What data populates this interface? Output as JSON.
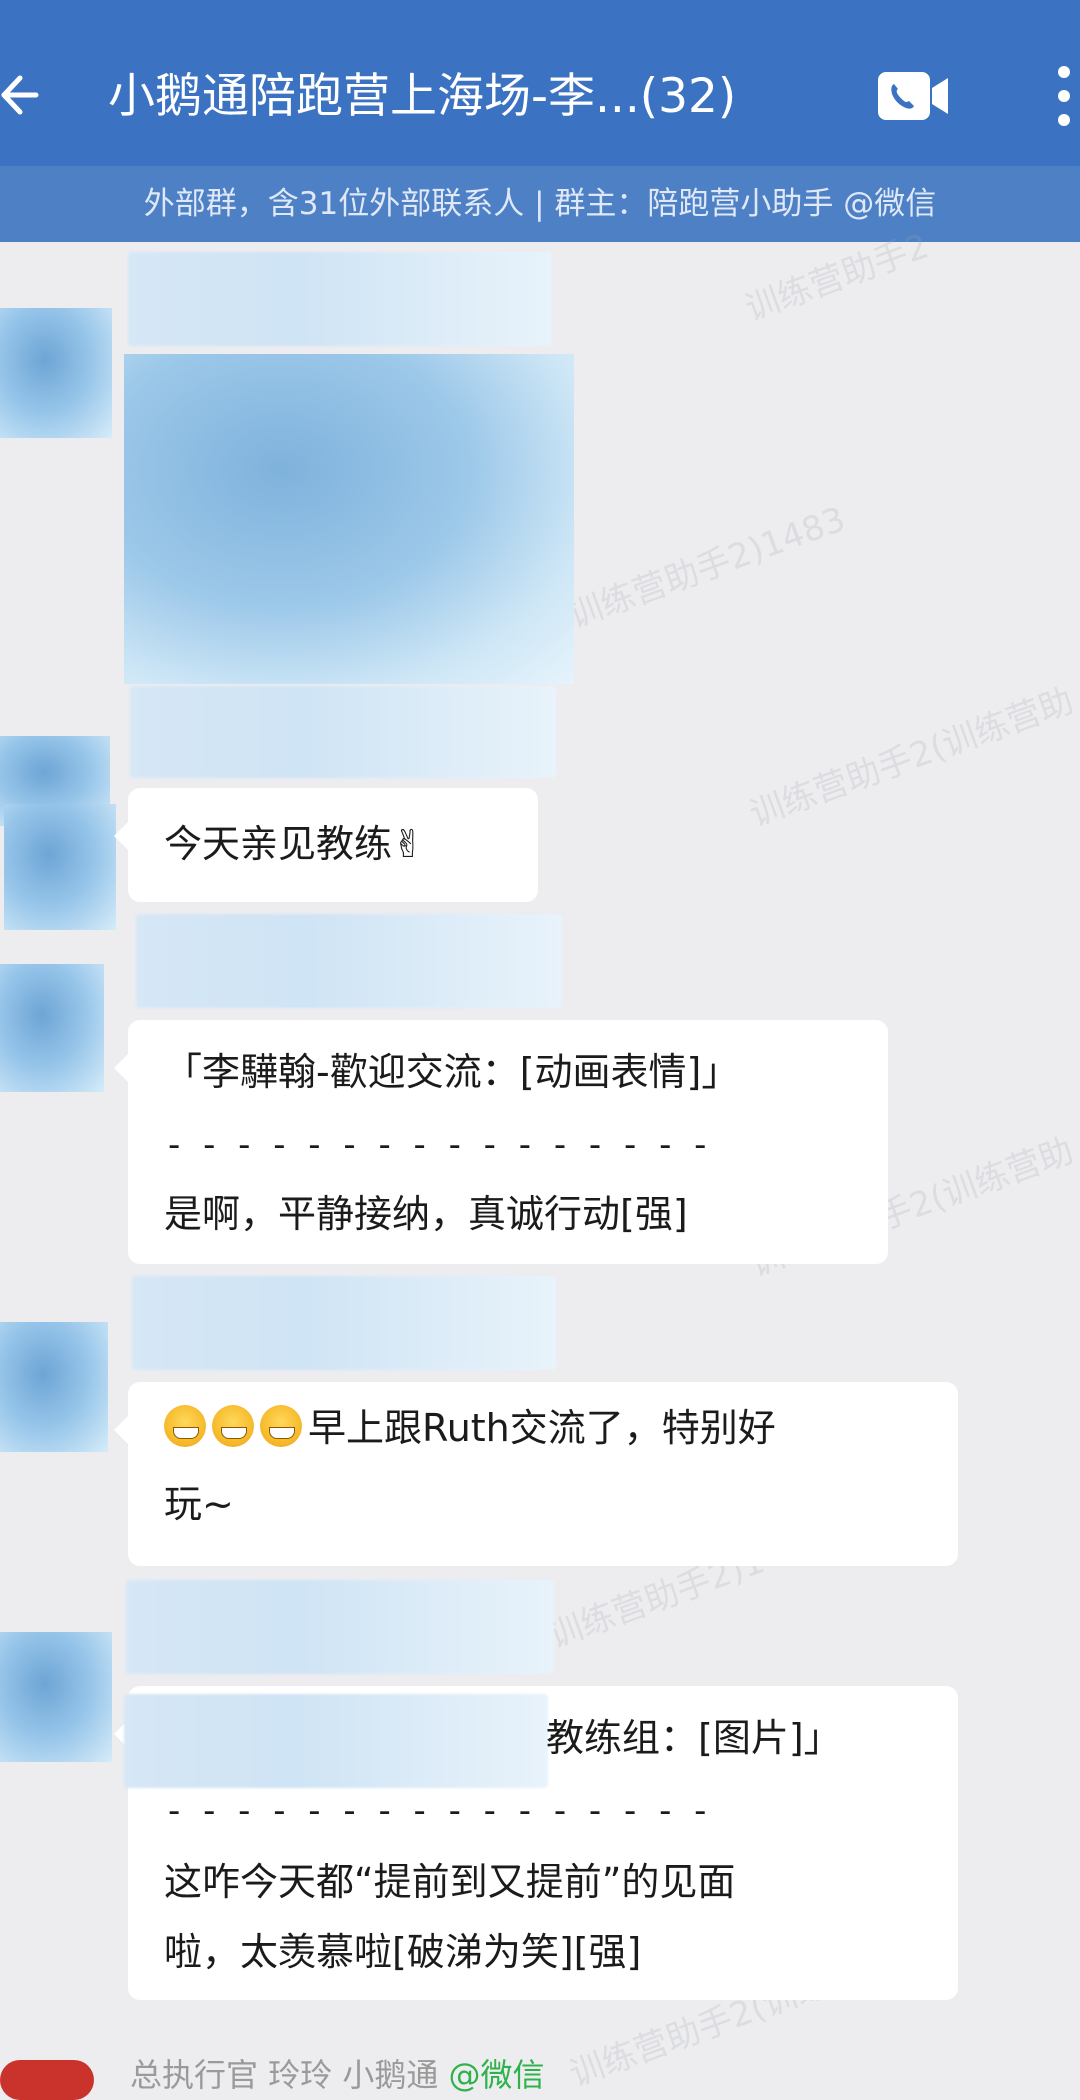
{
  "header": {
    "title": "小鹅通陪跑营上海场-李...(32)",
    "subtitle": "外部群，含31位外部联系人 | 群主：陪跑营小助手 @微信"
  },
  "watermark": {
    "texts": [
      "训练营助手2",
      "训练营助手2)1483",
      "训练营助手2(训练营助",
      "训练营助手2(训练营助",
      "训练营助手2)1483",
      "训练营助手2(训练营助"
    ]
  },
  "messages": [
    {
      "type": "image"
    },
    {
      "type": "text",
      "text": "今天亲见教练✌"
    },
    {
      "type": "quote",
      "quote": "「李驊翰-歡迎交流：[动画表情]」",
      "divider": "- - - - - - - - - - - - - - - -",
      "reply": "是啊，平静接纳，真诚行动[强]"
    },
    {
      "type": "text",
      "line1": "早上跟Ruth交流了，特别好",
      "line2": "玩~"
    },
    {
      "type": "quote",
      "quote": "教练组：[图片]」",
      "divider": "- - - - - - - - - - - - - - - -",
      "reply_line1": "这咋今天都“提前到又提前”的见面",
      "reply_line2": "啦，太羡慕啦[破涕为笑][强]"
    }
  ],
  "footer_sender": {
    "name": "总执行官 玲玲 小鹅通",
    "tag": "@微信"
  },
  "colors": {
    "header": "#3b72c2",
    "subbar": "#4e80c6",
    "background": "#ededf0",
    "bubble": "#ffffff",
    "wechat_tag": "#2fb24c"
  }
}
